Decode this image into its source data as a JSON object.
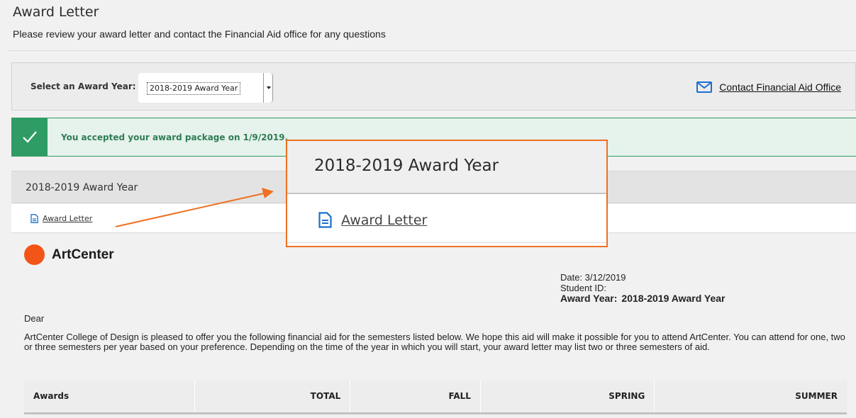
{
  "header": {
    "title": "Award Letter",
    "subtitle": "Please review your award letter and contact the Financial Aid office for any questions"
  },
  "selector": {
    "label": "Select an Award Year:",
    "selected_value": "2018-2019 Award Year",
    "contact_link": "Contact Financial Aid Office"
  },
  "banner": {
    "message": "You accepted your award package on 1/9/2019."
  },
  "section": {
    "year_title": "2018-2019 Award Year",
    "award_letter_link": "Award Letter"
  },
  "callout": {
    "title": "2018-2019 Award Year",
    "link": "Award Letter",
    "border_color": "#ee7023"
  },
  "letter": {
    "brand": "ArtCenter",
    "date": "Date: 3/12/2019",
    "student_id": "Student ID:",
    "award_year_label": "Award Year:",
    "award_year_value": "2018-2019 Award Year",
    "salutation": "Dear",
    "intro": "ArtCenter College of Design is pleased to offer you the following financial aid for the semesters listed below. We hope this aid will make it possible for you to attend ArtCenter. You can attend for one, two or three semesters per year based on your preference. Depending on the time of the year in which you will start, your award letter may list two or three semesters of aid."
  },
  "table": {
    "columns": [
      "Awards",
      "TOTAL",
      "FALL",
      "SPRING",
      "SUMMER"
    ]
  },
  "icons": {
    "mail": "mail-icon",
    "check": "check-icon",
    "document": "document-icon"
  },
  "colors": {
    "success": "#2e9c64",
    "accent": "#ee7023",
    "link_icon": "#1a6fd1",
    "brand_dot": "#f35417"
  }
}
